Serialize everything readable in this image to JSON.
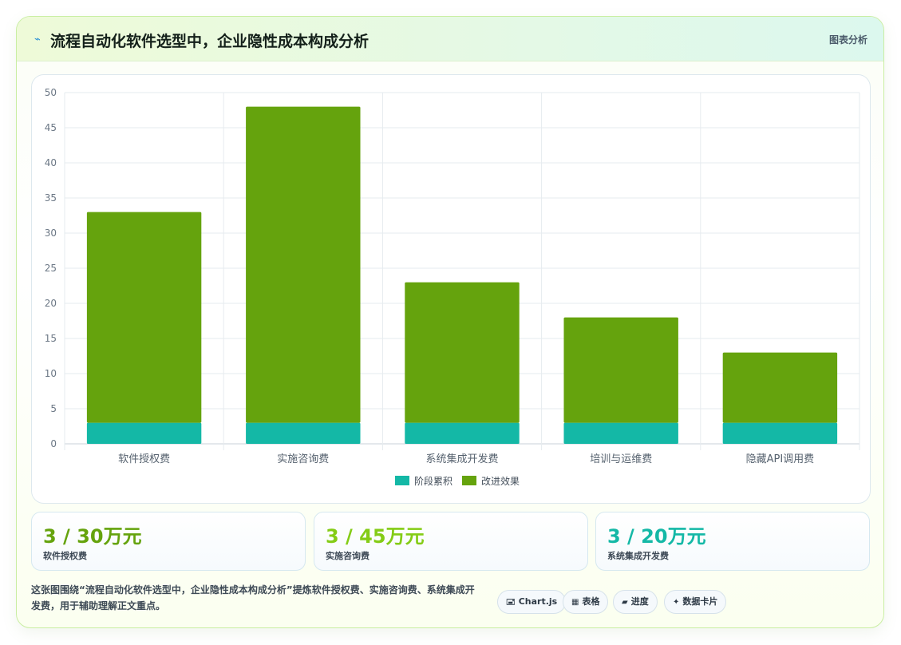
{
  "header": {
    "icon": "chart-line-icon",
    "title": "流程自动化软件选型中，企业隐性成本构成分析",
    "link_label": "图表分析"
  },
  "chart_data": {
    "type": "bar",
    "stacked": true,
    "categories": [
      "软件授权费",
      "实施咨询费",
      "系统集成开发费",
      "培训与运维费",
      "隐藏API调用费"
    ],
    "series": [
      {
        "name": "阶段累积",
        "color": "#14b8a6",
        "values": [
          3,
          3,
          3,
          3,
          3
        ]
      },
      {
        "name": "改进效果",
        "color": "#65a30d",
        "values": [
          30,
          45,
          20,
          15,
          10
        ]
      }
    ],
    "yticks": [
      0,
      5,
      10,
      15,
      20,
      25,
      30,
      35,
      40,
      45,
      50
    ],
    "ylim": [
      0,
      50
    ],
    "grid": true,
    "legend_position": "bottom"
  },
  "kpis": [
    {
      "value": "3 / 30万元",
      "label": "软件授权费",
      "color": "#65a30d"
    },
    {
      "value": "3 / 45万元",
      "label": "实施咨询费",
      "color": "#84cc16"
    },
    {
      "value": "3 / 20万元",
      "label": "系统集成开发费",
      "color": "#14b8a6"
    }
  ],
  "description": "这张图围绕“流程自动化软件选型中，企业隐性成本构成分析”提炼软件授权费、实施咨询费、系统集成开发费，用于辅助理解正文重点。",
  "tags": [
    {
      "icon": "🖃",
      "icon_name": "chart-icon",
      "label": "Chart.js"
    },
    {
      "icon": "▦",
      "icon_name": "table-icon",
      "label": "表格"
    },
    {
      "icon": "▰",
      "icon_name": "progress-icon",
      "label": "进度"
    },
    {
      "icon": "✦",
      "icon_name": "card-icon",
      "label": "数据卡片"
    }
  ]
}
